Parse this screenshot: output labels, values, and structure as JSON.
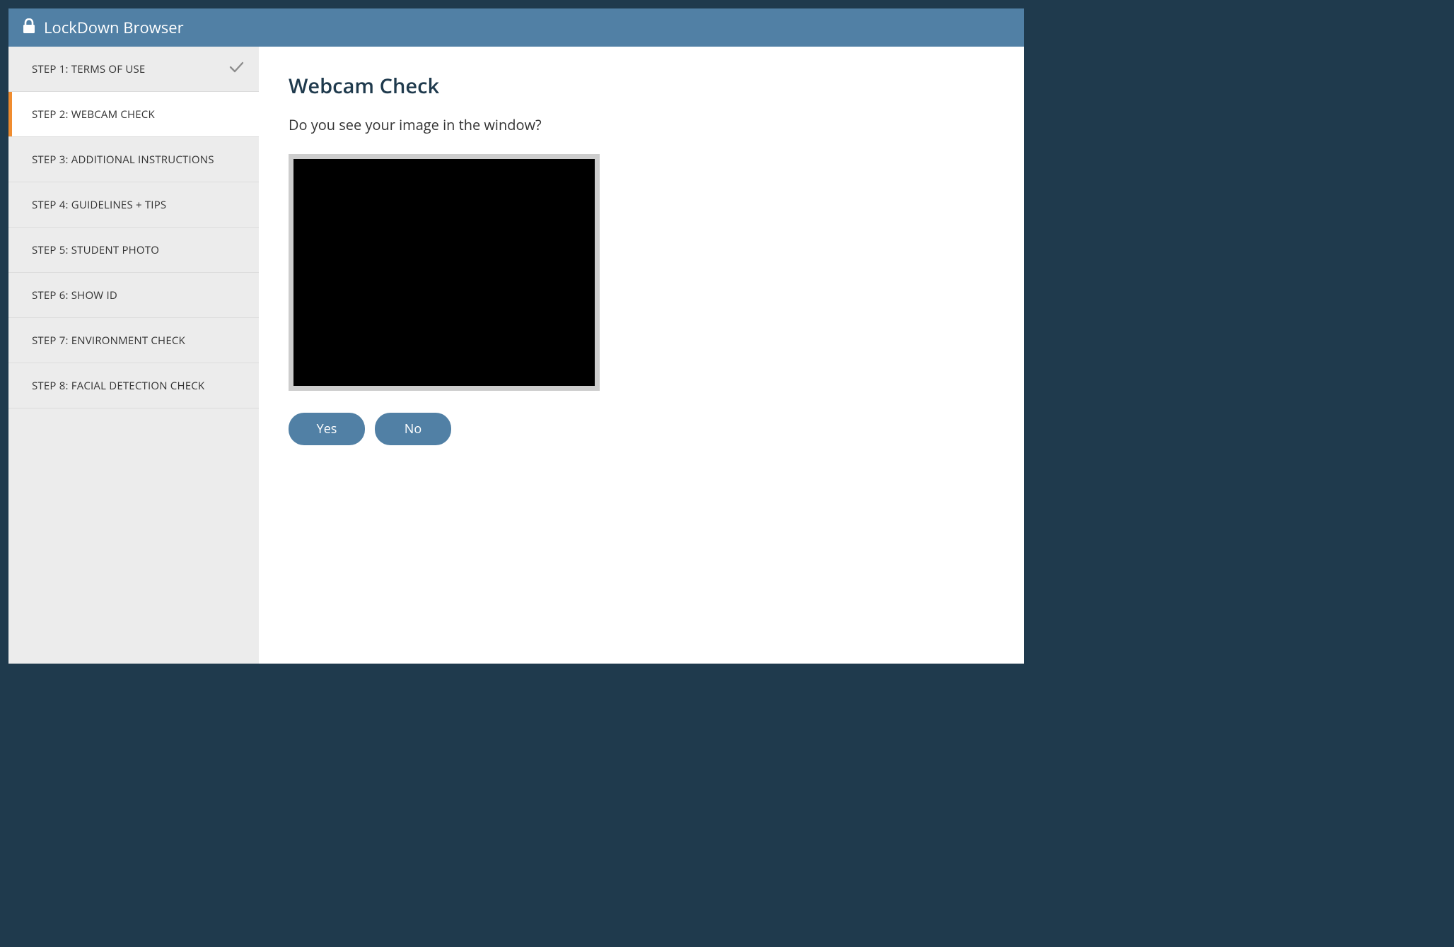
{
  "header": {
    "title": "LockDown Browser"
  },
  "sidebar": {
    "steps": [
      {
        "label": "STEP 1: TERMS OF USE",
        "state": "completed"
      },
      {
        "label": "STEP 2: WEBCAM CHECK",
        "state": "active"
      },
      {
        "label": "STEP 3: ADDITIONAL INSTRUCTIONS",
        "state": "pending"
      },
      {
        "label": "STEP 4: GUIDELINES + TIPS",
        "state": "pending"
      },
      {
        "label": "STEP 5: STUDENT PHOTO",
        "state": "pending"
      },
      {
        "label": "STEP 6: SHOW ID",
        "state": "pending"
      },
      {
        "label": "STEP 7: ENVIRONMENT CHECK",
        "state": "pending"
      },
      {
        "label": "STEP 8: FACIAL DETECTION CHECK",
        "state": "pending"
      }
    ]
  },
  "main": {
    "title": "Webcam Check",
    "question": "Do you see your image in the window?",
    "buttons": {
      "yes": "Yes",
      "no": "No"
    }
  },
  "colors": {
    "outer_bg": "#1f3a4d",
    "header_bg": "#5180a5",
    "accent_orange": "#f08c2f",
    "sidebar_bg": "#ececec"
  }
}
